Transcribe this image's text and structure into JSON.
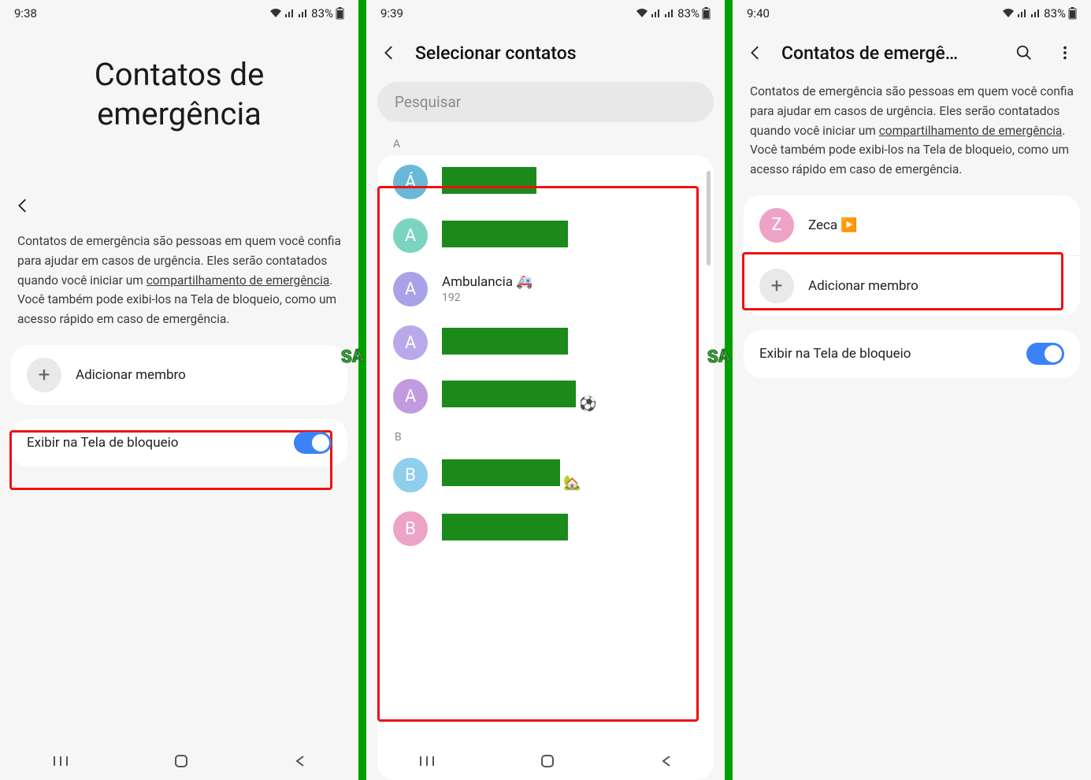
{
  "status": {
    "battery": "83%"
  },
  "screen1": {
    "time": "9:38",
    "largeTitle": "Contatos de emergência",
    "desc_p1": "Contatos de emergência são pessoas em quem você confia para ajudar em casos de urgência. Eles serão contatados quando você iniciar um ",
    "desc_link": "compartilhamento de emergência",
    "desc_p2": ". Você também pode exibi-los na Tela de bloqueio, como um acesso rápido em caso de emergência.",
    "addMember": "Adicionar membro",
    "lockToggle": "Exibir na Tela de bloqueio"
  },
  "screen2": {
    "time": "9:39",
    "appbarTitle": "Selecionar contatos",
    "searchPlaceholder": "Pesquisar",
    "sectionA": "A",
    "sectionB": "B",
    "contacts": [
      {
        "letter": "Á",
        "avatarColor": "#6ab8d8",
        "redactWidth": 120
      },
      {
        "letter": "A",
        "avatarColor": "#7bd4c0",
        "redactWidth": 160
      },
      {
        "letter": "A",
        "avatarColor": "#a9a2e8",
        "name": "Ambulancia 🚑",
        "sub": "192"
      },
      {
        "letter": "A",
        "avatarColor": "#b9a8ea",
        "redactWidth": 160
      },
      {
        "letter": "A",
        "avatarColor": "#c29ae0",
        "redactWidth": 170,
        "emoji": "⚽"
      },
      {
        "letter": "B",
        "avatarColor": "#8fcfec",
        "redactWidth": 150,
        "emoji": "🏡"
      },
      {
        "letter": "B",
        "avatarColor": "#eda3c6",
        "redactWidth": 160
      }
    ]
  },
  "screen3": {
    "time": "9:40",
    "appbarTitle": "Contatos de emergê…",
    "desc_p1": "Contatos de emergência são pessoas em quem você confia para ajudar em casos de urgência. Eles serão contatados quando você iniciar um ",
    "desc_link": "compartilhamento de emergência",
    "desc_p2": ". Você também pode exibi-los na Tela de bloqueio, como um acesso rápido em caso de emergência.",
    "contactName": "Zeca ▶️",
    "contactLetter": "Z",
    "addMember": "Adicionar membro",
    "lockToggle": "Exibir na Tela de bloqueio"
  }
}
